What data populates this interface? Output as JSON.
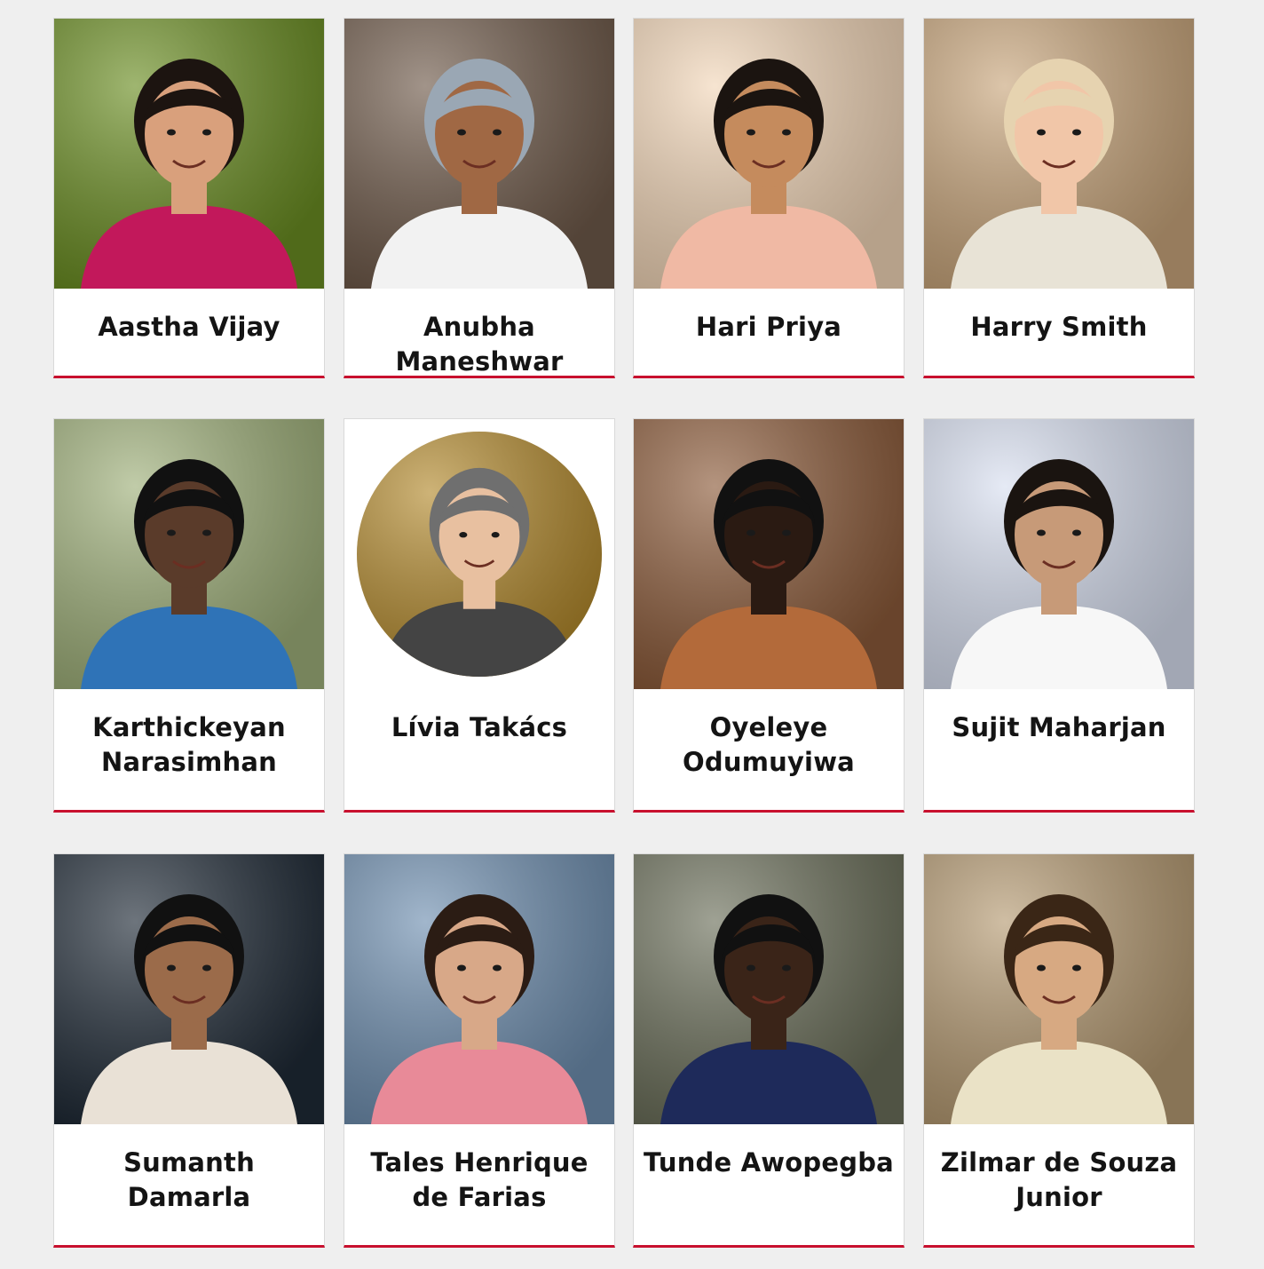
{
  "people": [
    {
      "name": "Aastha Vijay",
      "photo_bg": "#6b8e23",
      "skin": "#d9a07c",
      "hair": "#1c1410",
      "shirt": "#c2185b",
      "style": "square"
    },
    {
      "name": "Anubha Maneshwar",
      "photo_bg": "#6f5a4a",
      "skin": "#a06844",
      "hair": "#9aa7b4",
      "shirt": "#f2f2f2",
      "style": "square"
    },
    {
      "name": "Hari Priya",
      "photo_bg": "#f2d6b8",
      "skin": "#c58b5d",
      "hair": "#1b1410",
      "shirt": "#f0b9a4",
      "style": "square"
    },
    {
      "name": "Harry Smith",
      "photo_bg": "#c9a67c",
      "skin": "#f1c6a8",
      "hair": "#e6d3b0",
      "shirt": "#e8e3d6",
      "style": "square"
    },
    {
      "name": "Karthickeyan Narasimhan",
      "photo_bg": "#9fb07a",
      "skin": "#5a3b2a",
      "hair": "#111111",
      "shirt": "#2f73b7",
      "style": "square"
    },
    {
      "name": "Lívia Takács",
      "photo_bg": "#b38a2e",
      "skin": "#e8c0a0",
      "hair": "#6f6f6f",
      "shirt": "#444444",
      "style": "circle"
    },
    {
      "name": "Oyeleye Odumuyiwa",
      "photo_bg": "#8c5b3a",
      "skin": "#2a1a12",
      "hair": "#111111",
      "shirt": "#b36a3a",
      "style": "square"
    },
    {
      "name": "Sujit Maharjan",
      "photo_bg": "#d8dff0",
      "skin": "#c79a78",
      "hair": "#1a1410",
      "shirt": "#f7f7f7",
      "style": "square"
    },
    {
      "name": "Sumanth Damarla",
      "photo_bg": "#1f2a36",
      "skin": "#9b6b4a",
      "hair": "#111111",
      "shirt": "#e9e1d6",
      "style": "square"
    },
    {
      "name": "Tales Henrique de Farias",
      "photo_bg": "#6f8fb0",
      "skin": "#d8a888",
      "hair": "#2b1c14",
      "shirt": "#e88a98",
      "style": "square"
    },
    {
      "name": "Tunde Awopegba",
      "photo_bg": "#6b6f5a",
      "skin": "#3a2418",
      "hair": "#111111",
      "shirt": "#1e2a5a",
      "style": "square"
    },
    {
      "name": "Zilmar de Souza Junior",
      "photo_bg": "#b59a72",
      "skin": "#d7a982",
      "hair": "#3a2616",
      "shirt": "#eae2c6",
      "style": "square"
    }
  ],
  "accent": "#c8102e"
}
